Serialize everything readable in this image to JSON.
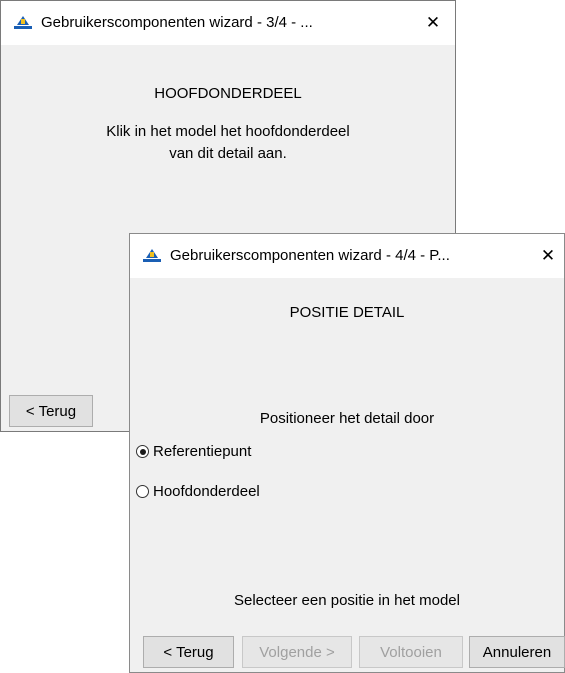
{
  "window_back": {
    "title": "Gebruikerscomponenten wizard - 3/4 - ...",
    "heading": "HOOFDONDERDEEL",
    "body_line1": "Klik in het model het hoofdonderdeel",
    "body_line2": "van dit detail aan.",
    "back_button": "< Terug",
    "close_glyph": "✕"
  },
  "window_front": {
    "title": "Gebruikerscomponenten wizard - 4/4 - P...",
    "heading": "POSITIE DETAIL",
    "instruction": "Positioneer het detail door",
    "options": [
      {
        "label": "Referentiepunt",
        "selected": true
      },
      {
        "label": "Hoofdonderdeel",
        "selected": false
      }
    ],
    "status": "Selecteer een positie in het model",
    "buttons": {
      "back": "< Terug",
      "next": "Volgende >",
      "finish": "Voltooien",
      "cancel": "Annuleren"
    },
    "close_glyph": "✕"
  },
  "icons": {
    "app": "app-icon",
    "close": "close-icon"
  },
  "colors": {
    "icon_blue": "#1a5fb4",
    "icon_yellow": "#f0c020",
    "disabled_text": "#a0a0a0"
  }
}
